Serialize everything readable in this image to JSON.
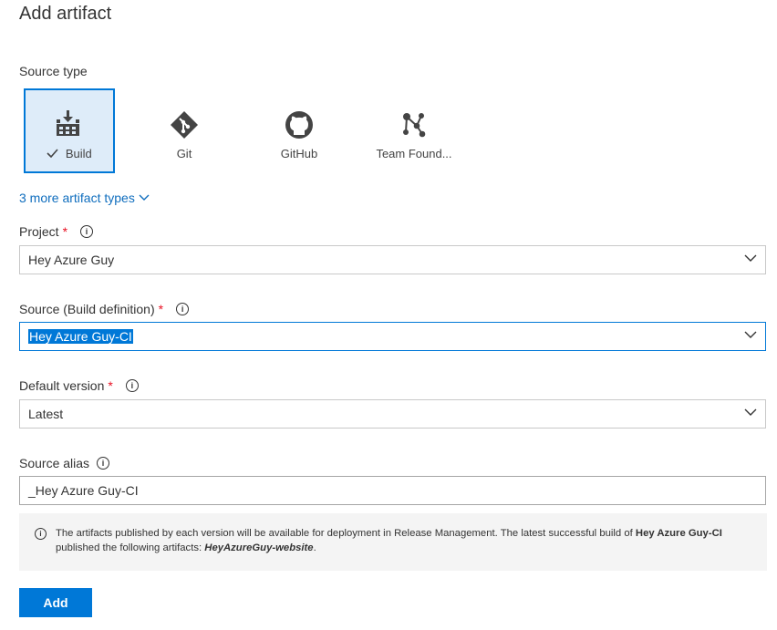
{
  "title": "Add artifact",
  "source_type": {
    "label": "Source type",
    "tiles": [
      {
        "label": "Build",
        "icon": "build-icon",
        "selected": true
      },
      {
        "label": "Git",
        "icon": "git-icon",
        "selected": false
      },
      {
        "label": "GitHub",
        "icon": "github-icon",
        "selected": false
      },
      {
        "label": "Team Found...",
        "icon": "team-foundation-icon",
        "selected": false
      }
    ],
    "more_link": "3 more artifact types"
  },
  "project": {
    "label": "Project",
    "required": "*",
    "value": "Hey Azure Guy"
  },
  "source": {
    "label": "Source (Build definition)",
    "required": "*",
    "value": "Hey Azure Guy-CI"
  },
  "default_version": {
    "label": "Default version",
    "required": "*",
    "value": "Latest"
  },
  "source_alias": {
    "label": "Source alias",
    "value": "_Hey Azure Guy-CI"
  },
  "info_message": {
    "prefix": "The artifacts published by each version will be available for deployment in Release Management. The latest successful build of ",
    "build_name": "Hey Azure Guy-CI",
    "middle": " published the following artifacts: ",
    "artifact": "HeyAzureGuy-website",
    "suffix": "."
  },
  "add_button": "Add",
  "colors": {
    "accent": "#0078d7",
    "selected_bg": "#deecf9",
    "required": "#e81123",
    "info_bg": "#f4f4f4"
  }
}
